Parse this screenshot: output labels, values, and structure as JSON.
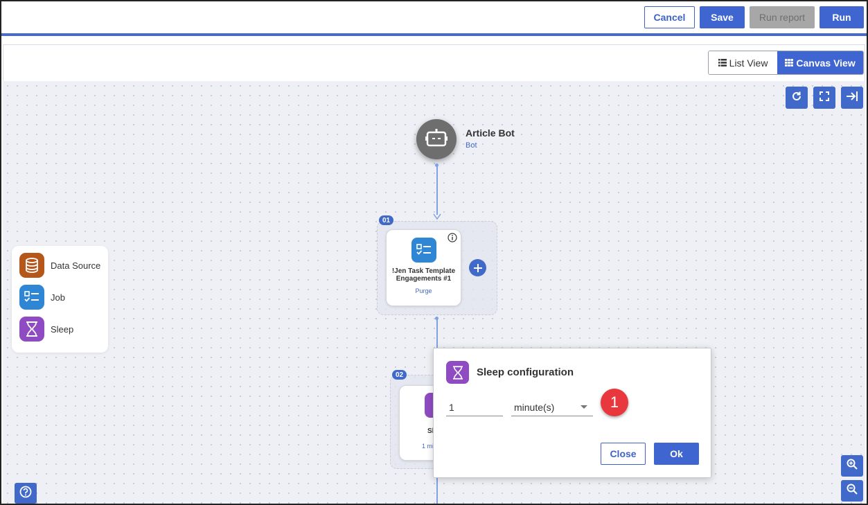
{
  "toolbar": {
    "cancel_label": "Cancel",
    "save_label": "Save",
    "run_report_label": "Run report",
    "run_label": "Run"
  },
  "view_toggle": {
    "list_label": "List View",
    "canvas_label": "Canvas View",
    "active": "Canvas View"
  },
  "canvas_tools": [
    "refresh-icon",
    "fullscreen-icon",
    "collapse-panel-icon"
  ],
  "bot": {
    "title": "Article Bot",
    "type": "Bot"
  },
  "steps": [
    {
      "badge": "01",
      "title_line1": "!Jen Task Template",
      "title_line2": "Engagements #1",
      "subtitle": "Purge"
    },
    {
      "badge": "02",
      "title_partial": "Sl",
      "subtitle_partial": "1 mi"
    }
  ],
  "palette": {
    "items": [
      {
        "label": "Data Source",
        "icon": "database-icon",
        "color": "#b5561b"
      },
      {
        "label": "Job",
        "icon": "checklist-icon",
        "color": "#2f86d4"
      },
      {
        "label": "Sleep",
        "icon": "hourglass-icon",
        "color": "#8f4bc1"
      }
    ]
  },
  "sleep_dialog": {
    "title": "Sleep configuration",
    "amount": "1",
    "unit": "minute(s)",
    "callout_number": "1",
    "close_label": "Close",
    "ok_label": "Ok"
  },
  "colors": {
    "primary": "#3f66d0",
    "sleep": "#8f4bc1",
    "callout": "#e8383d"
  }
}
